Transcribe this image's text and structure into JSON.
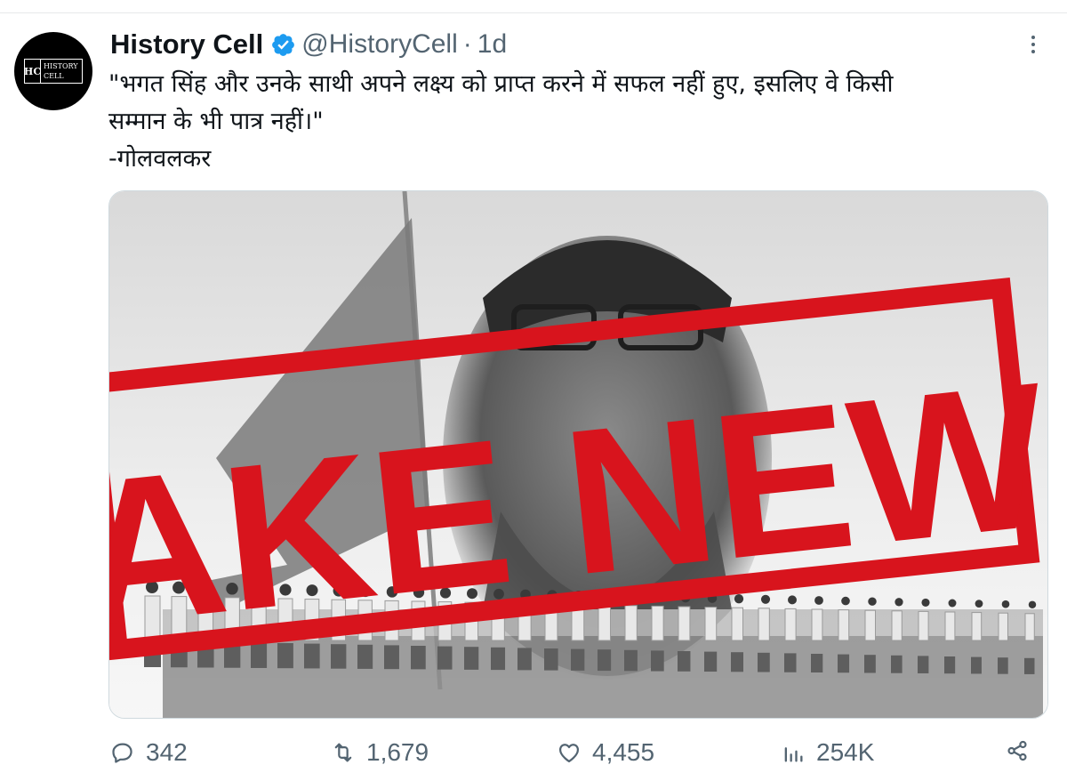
{
  "divider": "top",
  "tweet": {
    "author": {
      "name": "History Cell",
      "handle": "@HistoryCell",
      "verified": true,
      "verified_color": "#1d9bf0",
      "avatar_mono": "HC",
      "avatar_words_1": "HISTORY",
      "avatar_words_2": "CELL"
    },
    "separator": "·",
    "time": "1d",
    "text": "\"भगत सिंह और उनके साथी अपने लक्ष्य को प्राप्त करने में सफल नहीं हुए, इसलिए वे किसी\nसम्मान के भी पात्र नहीं।\"\n-गोलवलकर",
    "media": {
      "stamp_text": "FAKE NEWS",
      "stamp_color": "#d8141d"
    },
    "actions": {
      "replies": "342",
      "reposts": "1,679",
      "likes": "4,455",
      "views": "254K"
    }
  },
  "icons": {
    "more": "more-vertical-icon",
    "reply": "speech-bubble-icon",
    "repost": "repost-arrows-icon",
    "like": "heart-icon",
    "views": "bar-chart-icon",
    "share": "share-icon"
  }
}
